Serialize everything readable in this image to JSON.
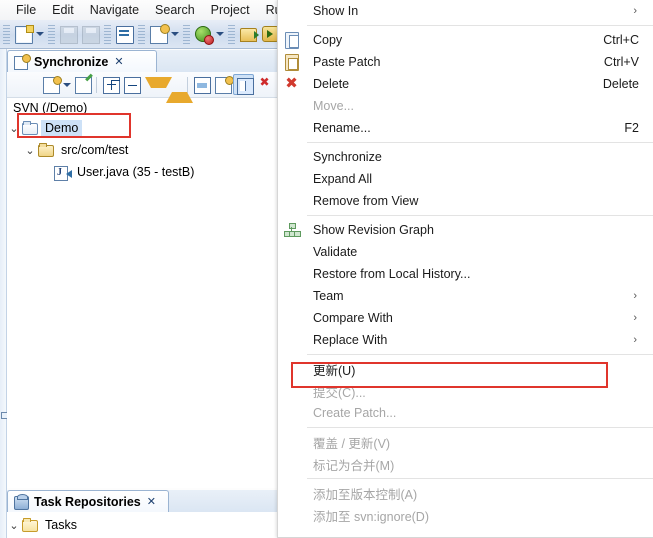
{
  "window": {
    "menubar": [
      "File",
      "Edit",
      "Navigate",
      "Search",
      "Project",
      "Run"
    ]
  },
  "main_toolbar": {
    "items": [
      {
        "name": "new-wizard-icon",
        "icon": "new-file"
      },
      {
        "name": "toolbar-dropdown-arrow",
        "icon": "dropdown-arrow"
      },
      {
        "name": "save-icon",
        "icon": "save"
      },
      {
        "name": "save-all-icon",
        "icon": "save-all"
      },
      {
        "name": "open-console-icon",
        "icon": "console"
      },
      {
        "name": "svn-synchronize-icon",
        "icon": "svn"
      },
      {
        "name": "toolbar-dropdown-arrow",
        "icon": "dropdown-arrow"
      },
      {
        "name": "debug-icon",
        "icon": "debug"
      },
      {
        "name": "toolbar-dropdown-arrow",
        "icon": "dropdown-arrow"
      },
      {
        "name": "run-icon",
        "icon": "run"
      },
      {
        "name": "external-tools-icon",
        "icon": "external"
      },
      {
        "name": "toolbar-dropdown-arrow",
        "icon": "dropdown-arrow"
      }
    ]
  },
  "sync_view": {
    "tab_label": "Synchronize",
    "tab_close": "✕",
    "root_label": "SVN (/Demo)",
    "toolbar_items": [
      {
        "name": "sync-mode-icon",
        "icon": "pin"
      },
      {
        "name": "sync-dropdown-arrow",
        "icon": "dropdown-arrow"
      },
      {
        "name": "open-in-compare-editor-icon",
        "icon": "pencil"
      },
      {
        "name": "expand-all-icon",
        "icon": "plusbox"
      },
      {
        "name": "collapse-all-icon",
        "icon": "minusbox"
      },
      {
        "name": "next-change-icon",
        "icon": "down-arrow"
      },
      {
        "name": "previous-change-icon",
        "icon": "up-arrow"
      },
      {
        "name": "incoming-mode-icon",
        "icon": "sync"
      },
      {
        "name": "outgoing-mode-icon",
        "icon": "pin2"
      },
      {
        "name": "both-mode-icon",
        "icon": "mode"
      },
      {
        "name": "conflicts-mode-icon",
        "icon": "red"
      }
    ],
    "tree": [
      {
        "label": "Demo",
        "icon": "folder",
        "level": 0,
        "twisty": "⌄",
        "selected": true,
        "highlighted": true
      },
      {
        "label": "src/com/test",
        "icon": "package",
        "level": 1,
        "twisty": "⌄",
        "selected": false,
        "highlighted": false
      },
      {
        "label": "User.java (35 - testB)",
        "icon": "java-file",
        "level": 2,
        "twisty": "",
        "selected": false,
        "highlighted": false
      }
    ]
  },
  "task_view": {
    "tab_label": "Task Repositories",
    "tab_close": "✕",
    "tree": [
      {
        "label": "Tasks",
        "icon": "folder",
        "twisty": "⌄"
      }
    ]
  },
  "context_menu": {
    "groups": [
      {
        "items": [
          {
            "label": "Show In",
            "accel": "",
            "submenu": true,
            "disabled": false,
            "icon": "",
            "highlighted": false
          }
        ]
      },
      {
        "items": [
          {
            "label": "Copy",
            "accel": "Ctrl+C",
            "submenu": false,
            "disabled": false,
            "icon": "copy",
            "highlighted": false
          },
          {
            "label": "Paste Patch",
            "accel": "Ctrl+V",
            "submenu": false,
            "disabled": false,
            "icon": "paste",
            "highlighted": false
          },
          {
            "label": "Delete",
            "accel": "Delete",
            "submenu": false,
            "disabled": false,
            "icon": "delete",
            "highlighted": false
          },
          {
            "label": "Move...",
            "accel": "",
            "submenu": false,
            "disabled": true,
            "icon": "",
            "highlighted": false
          },
          {
            "label": "Rename...",
            "accel": "F2",
            "submenu": false,
            "disabled": false,
            "icon": "",
            "highlighted": false
          }
        ]
      },
      {
        "items": [
          {
            "label": "Synchronize",
            "accel": "",
            "submenu": false,
            "disabled": false,
            "icon": "",
            "highlighted": false
          },
          {
            "label": "Expand All",
            "accel": "",
            "submenu": false,
            "disabled": false,
            "icon": "",
            "highlighted": false
          },
          {
            "label": "Remove from View",
            "accel": "",
            "submenu": false,
            "disabled": false,
            "icon": "",
            "highlighted": false
          }
        ]
      },
      {
        "items": [
          {
            "label": "Show Revision Graph",
            "accel": "",
            "submenu": false,
            "disabled": false,
            "icon": "graph",
            "highlighted": false
          },
          {
            "label": "Validate",
            "accel": "",
            "submenu": false,
            "disabled": false,
            "icon": "",
            "highlighted": false
          },
          {
            "label": "Restore from Local History...",
            "accel": "",
            "submenu": false,
            "disabled": false,
            "icon": "",
            "highlighted": false
          },
          {
            "label": "Team",
            "accel": "",
            "submenu": true,
            "disabled": false,
            "icon": "",
            "highlighted": false
          },
          {
            "label": "Compare With",
            "accel": "",
            "submenu": true,
            "disabled": false,
            "icon": "",
            "highlighted": false
          },
          {
            "label": "Replace With",
            "accel": "",
            "submenu": true,
            "disabled": false,
            "icon": "",
            "highlighted": false
          }
        ]
      },
      {
        "items": [
          {
            "label": "更新(U)",
            "accel": "",
            "submenu": false,
            "disabled": false,
            "icon": "",
            "highlighted": true
          },
          {
            "label": "提交(C)...",
            "accel": "",
            "submenu": false,
            "disabled": true,
            "icon": "",
            "highlighted": false
          },
          {
            "label": "Create Patch...",
            "accel": "",
            "submenu": false,
            "disabled": true,
            "icon": "",
            "highlighted": false
          }
        ]
      },
      {
        "items": [
          {
            "label": "覆盖 / 更新(V)",
            "accel": "",
            "submenu": false,
            "disabled": true,
            "icon": "",
            "highlighted": false
          },
          {
            "label": "标记为合并(M)",
            "accel": "",
            "submenu": false,
            "disabled": true,
            "icon": "",
            "highlighted": false
          }
        ]
      },
      {
        "items": [
          {
            "label": "添加至版本控制(A)",
            "accel": "",
            "submenu": false,
            "disabled": true,
            "icon": "",
            "highlighted": false
          },
          {
            "label": "添加至 svn:ignore(D)",
            "accel": "",
            "submenu": false,
            "disabled": true,
            "icon": "",
            "highlighted": false
          }
        ]
      }
    ],
    "submenu_arrow": "›"
  },
  "colors": {
    "highlight_red": "#e0352c",
    "selection_blue": "#cde1f7",
    "toolbar_blue": "#cfdcee"
  }
}
